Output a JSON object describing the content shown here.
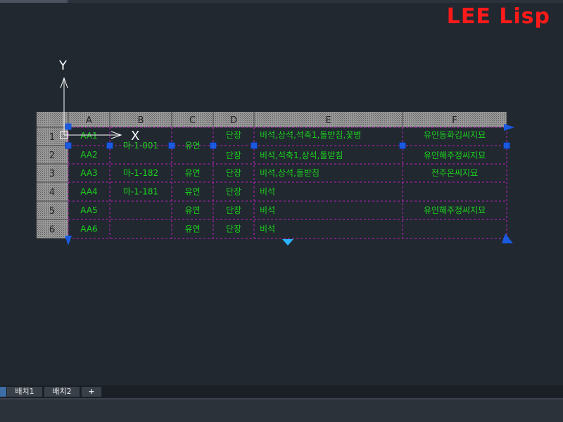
{
  "watermark": "LEE Lisp",
  "ucs": {
    "x_label": "X",
    "y_label": "Y"
  },
  "table": {
    "columns": [
      "A",
      "B",
      "C",
      "D",
      "E",
      "F"
    ],
    "row_numbers": [
      "1",
      "2",
      "3",
      "4",
      "5",
      "6"
    ],
    "rows": [
      [
        "AA1",
        "마-1-001",
        "유연",
        "단장",
        "비석,상석,석축1,돌받침,꽃병",
        "유인동화김씨지묘"
      ],
      [
        "AA2",
        "",
        "",
        "단장",
        "비석,석축1,상석,돌받침",
        "유인해주정씨지묘"
      ],
      [
        "AA3",
        "마-1-182",
        "유연",
        "단장",
        "비석,상석,돌받침",
        "전주온씨지묘"
      ],
      [
        "AA4",
        "마-1-181",
        "유연",
        "단장",
        "비석",
        ""
      ],
      [
        "AA5",
        "",
        "유연",
        "단장",
        "비석",
        "유인해주정씨지묘"
      ],
      [
        "AA6",
        "",
        "유연",
        "단장",
        "비석",
        ""
      ]
    ]
  },
  "layout_tabs": [
    "배치1",
    "배치2",
    "+"
  ],
  "colors": {
    "background": "#212830",
    "cell_text": "#1cd41c",
    "grid": "#c020c0",
    "grip": "#1a5ae0",
    "watermark": "#ff1a1a"
  }
}
